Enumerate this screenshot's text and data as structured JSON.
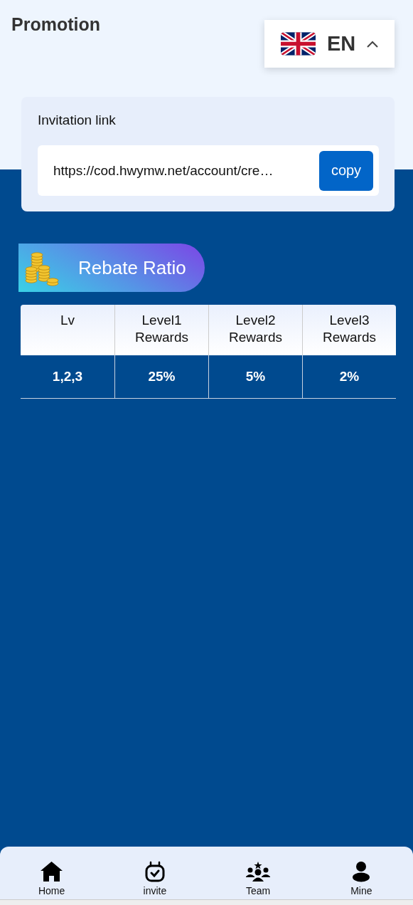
{
  "header": {
    "title": "Promotion",
    "language": {
      "code": "EN",
      "expanded": true
    }
  },
  "invitation": {
    "label": "Invitation link",
    "link": "https://cod.hwymw.net/account/cre…",
    "button": "copy"
  },
  "rebate": {
    "title": "Rebate Ratio",
    "table": {
      "columns": [
        {
          "line1": "Lv"
        },
        {
          "line1": "Level1",
          "line2": "Rewards"
        },
        {
          "line1": "Level2",
          "line2": "Rewards"
        },
        {
          "line1": "Level3",
          "line2": "Rewards"
        }
      ],
      "rows": [
        [
          "1,2,3",
          "25%",
          "5%",
          "2%"
        ]
      ]
    }
  },
  "nav": [
    {
      "label": "Home",
      "kind": "home"
    },
    {
      "label": "invite",
      "kind": "invite"
    },
    {
      "label": "Team",
      "kind": "team"
    },
    {
      "label": "Mine",
      "kind": "mine"
    }
  ]
}
